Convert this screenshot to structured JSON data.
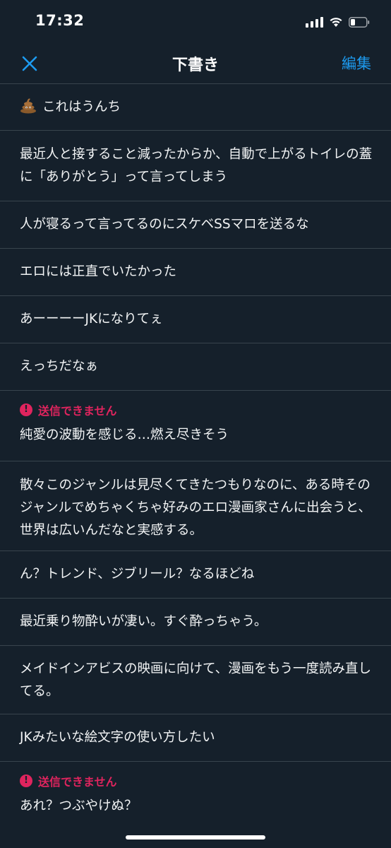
{
  "status": {
    "time": "17:32"
  },
  "nav": {
    "title": "下書き",
    "edit_label": "編集"
  },
  "error_label": "送信できません",
  "drafts": [
    {
      "text": "これはうんち",
      "emoji": "pile-of-poo"
    },
    {
      "text": "最近人と接すること減ったからか、自動で上がるトイレの蓋に「ありがとう」って言ってしまう"
    },
    {
      "text": "人が寝るって言ってるのにスケベSSマロを送るな"
    },
    {
      "text": "エロには正直でいたかった"
    },
    {
      "text": "あーーーーJKになりてぇ"
    },
    {
      "text": "えっちだなぁ"
    },
    {
      "text": "純愛の波動を感じる…燃え尽きそう",
      "error": true
    },
    {
      "text": "散々このジャンルは見尽くてきたつもりなのに、ある時そのジャンルでめちゃくちゃ好みのエロ漫画家さんに出会うと、世界は広いんだなと実感する。"
    },
    {
      "text": "ん？トレンド、ジブリール？なるほどね"
    },
    {
      "text": "最近乗り物酔いが凄い。すぐ酔っちゃう。"
    },
    {
      "text": "メイドインアビスの映画に向けて、漫画をもう一度読み直してる。"
    },
    {
      "text": "JKみたいな絵文字の使い方したい"
    },
    {
      "text": "あれ？つぶやけぬ？",
      "error": true
    }
  ],
  "colors": {
    "background": "#15202b",
    "accent": "#1d9bf0",
    "error": "#e0245e",
    "divider": "#38444d"
  }
}
